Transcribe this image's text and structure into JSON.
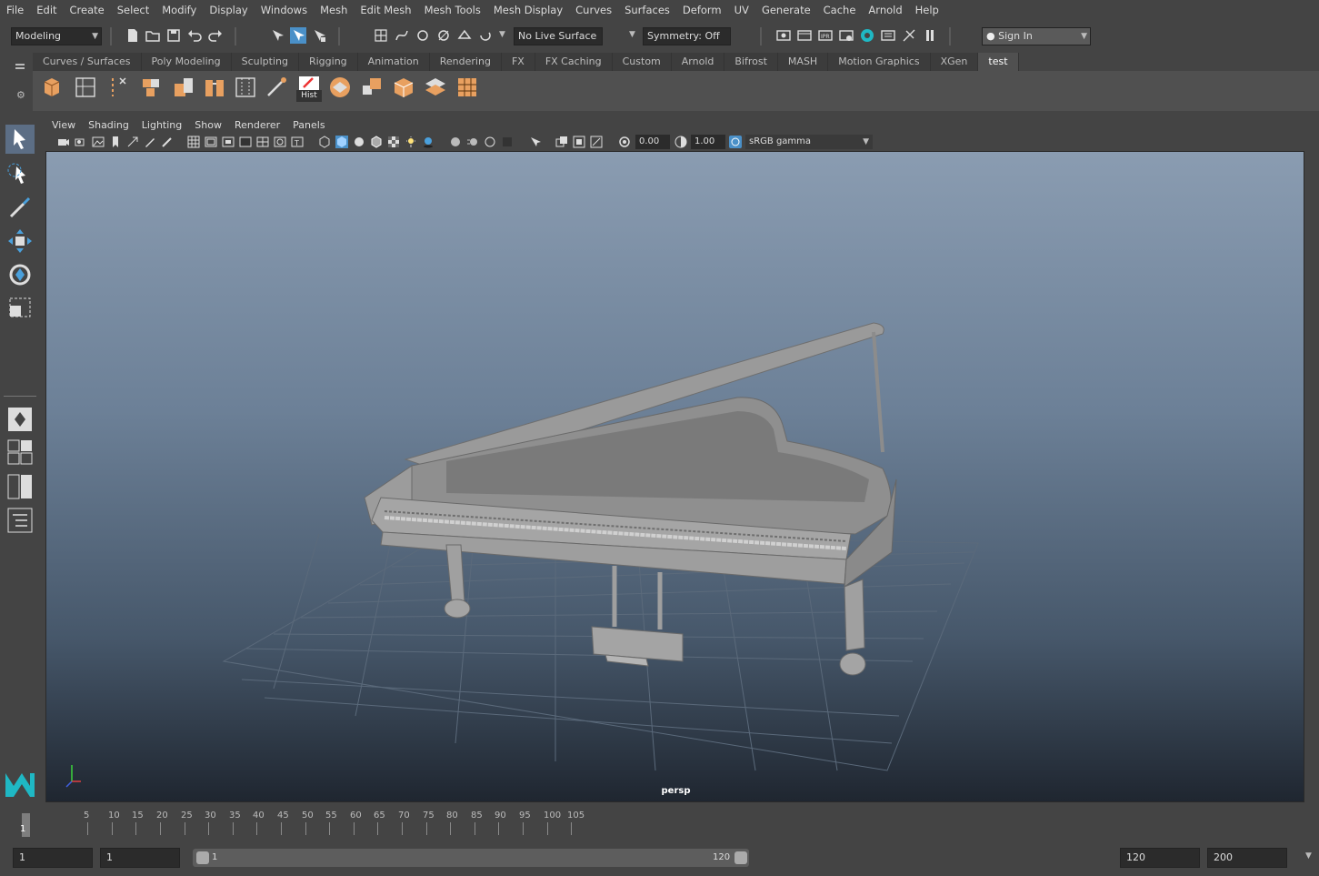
{
  "menubar": {
    "items": [
      "File",
      "Edit",
      "Create",
      "Select",
      "Modify",
      "Display",
      "Windows",
      "Mesh",
      "Edit Mesh",
      "Mesh Tools",
      "Mesh Display",
      "Curves",
      "Surfaces",
      "Deform",
      "UV",
      "Generate",
      "Cache",
      "Arnold",
      "Help"
    ]
  },
  "statusline": {
    "menu_set": "Modeling",
    "live_surface": "No Live Surface",
    "symmetry": "Symmetry: Off",
    "sign_in": "Sign In"
  },
  "shelf": {
    "tabs": [
      "Curves / Surfaces",
      "Poly Modeling",
      "Sculpting",
      "Rigging",
      "Animation",
      "Rendering",
      "FX",
      "FX Caching",
      "Custom",
      "Arnold",
      "Bifrost",
      "MASH",
      "Motion Graphics",
      "XGen",
      "test"
    ],
    "active_tab": "test",
    "hist_label": "Hist"
  },
  "panel": {
    "menus": [
      "View",
      "Shading",
      "Lighting",
      "Show",
      "Renderer",
      "Panels"
    ],
    "exposure": "0.00",
    "gamma": "1.00",
    "color_space": "sRGB gamma",
    "camera_label": "persp"
  },
  "timeline": {
    "tick_labels": [
      "5",
      "10",
      "15",
      "20",
      "25",
      "30",
      "35",
      "40",
      "45",
      "50",
      "55",
      "60",
      "65",
      "70",
      "75",
      "80",
      "85",
      "90",
      "95",
      "100",
      "105"
    ],
    "current_frame": "1"
  },
  "range": {
    "start_time": "1",
    "playback_start": "1",
    "range_start": "1",
    "range_end": "120",
    "playback_end": "120",
    "end_time": "200"
  },
  "colors": {
    "accent_blue": "#4a90c8",
    "maya_logo": "#1fb8c4"
  }
}
